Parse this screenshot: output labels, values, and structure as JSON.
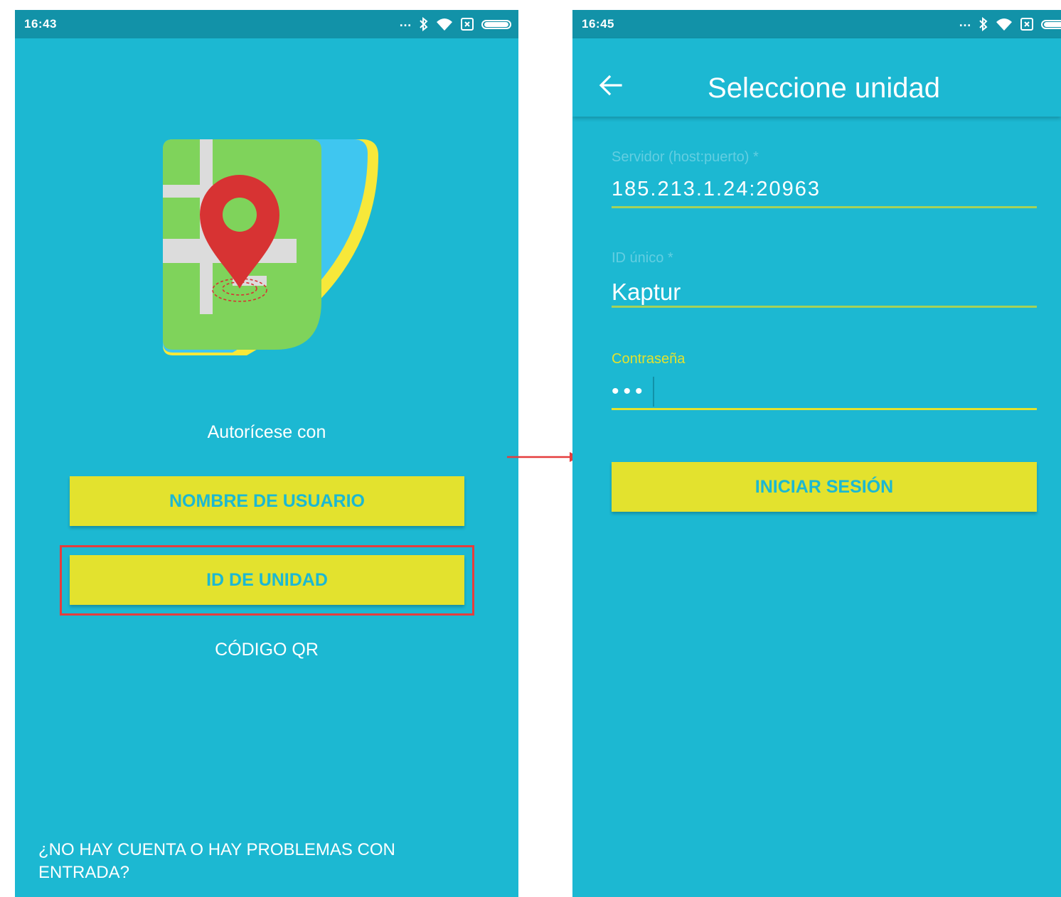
{
  "left_screen": {
    "status_bar": {
      "time": "16:43",
      "icons": [
        "ellipsis-icon",
        "bluetooth-icon",
        "wifi-icon",
        "sim-icon",
        "battery-icon"
      ]
    },
    "logo": {
      "icon": "map-pin-logo-icon",
      "colors": {
        "map": "#7fd35b",
        "road": "#dcdcdc",
        "pin": "#d73333",
        "layer_blue": "#3fc6f0",
        "layer_yellow": "#f7e83a"
      }
    },
    "auth_label": "Autorícese con",
    "buttons": {
      "username": "NOMBRE DE USUARIO",
      "unit_id": "ID DE UNIDAD"
    },
    "qr_link": "CÓDIGO QR",
    "help_link": "¿NO HAY CUENTA O HAY PROBLEMAS CON ENTRADA?"
  },
  "right_screen": {
    "status_bar": {
      "time": "16:45",
      "icons": [
        "ellipsis-icon",
        "bluetooth-icon",
        "wifi-icon",
        "sim-icon",
        "battery-icon"
      ]
    },
    "app_bar": {
      "back_icon": "arrow-left-icon",
      "title": "Seleccione unidad"
    },
    "form": {
      "server": {
        "label": "Servidor (host:puerto) *",
        "value": "185.213.1.24:20963"
      },
      "unique_id": {
        "label": "ID único *",
        "value": "Kaptur"
      },
      "password": {
        "label": "Contraseña",
        "value": "•••"
      },
      "login_button": "INICIAR SESIÓN"
    }
  },
  "colors": {
    "background": "#1cb8d2",
    "status_bar": "#1292a8",
    "button": "#e3e22e",
    "button_text": "#1cb8d2",
    "highlight": "#e53d3d",
    "field_line": "#a4d25a"
  }
}
